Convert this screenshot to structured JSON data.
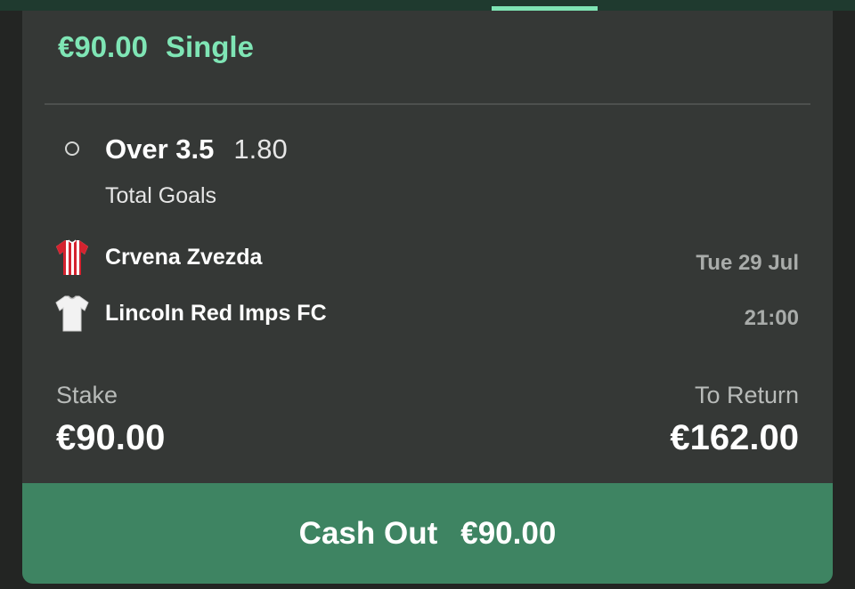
{
  "bet": {
    "amount": "€90.00",
    "type": "Single"
  },
  "selection": {
    "name": "Over 3.5",
    "odds": "1.80",
    "market": "Total Goals"
  },
  "event": {
    "home_team": "Crvena Zvezda",
    "away_team": "Lincoln Red Imps FC",
    "date": "Tue 29 Jul",
    "time": "21:00",
    "home_jersey_icon": "striped-jersey-icon",
    "away_jersey_icon": "white-jersey-icon"
  },
  "stake": {
    "label": "Stake",
    "value": "€90.00"
  },
  "to_return": {
    "label": "To Return",
    "value": "€162.00"
  },
  "cash_out": {
    "label": "Cash Out",
    "amount": "€90.00"
  },
  "colors": {
    "accent": "#7fe5b5",
    "card_bg": "#353836",
    "cash_out_bg": "#3e8462"
  }
}
